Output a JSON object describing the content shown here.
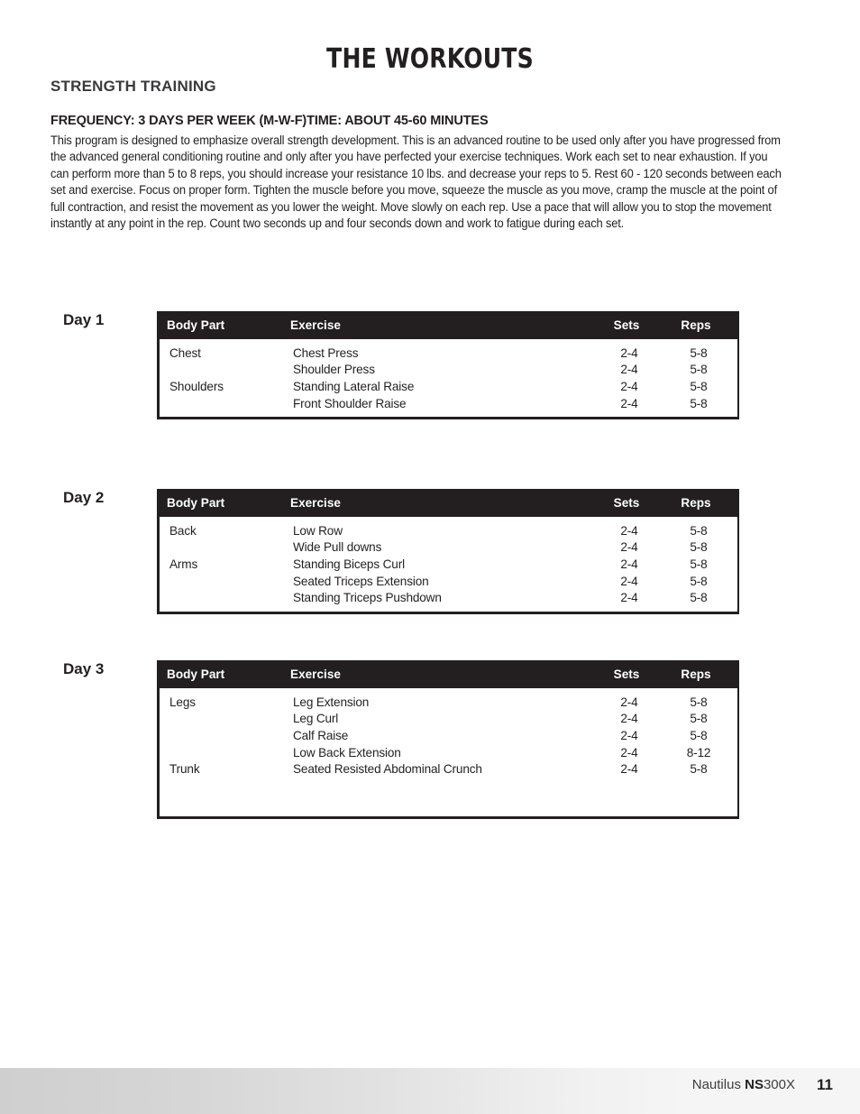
{
  "document": {
    "title": "THE WORKOUTS",
    "section_heading": "STRENGTH TRAINING",
    "frequency_heading": "FREQUENCY: 3 DAYS PER WEEK (M-W-F)TIME: ABOUT 45-60 MINUTES",
    "intro_paragraph": "This program is designed to emphasize overall strength development. This is an advanced routine to be used only after you have progressed from the advanced general conditioning routine and only after you have perfected your exercise techniques. Work each set to near exhaustion. If you can perform more than 5 to 8 reps, you should increase your resistance 10 lbs. and decrease your reps to 5. Rest 60 - 120 seconds between each set and exercise. Focus on proper form. Tighten the muscle before you move, squeeze the muscle as you move, cramp the muscle at the point of full contraction, and resist the movement as you lower the weight. Move slowly on each rep. Use a pace that will allow you to stop the movement instantly at any point in the rep. Count two seconds up and four seconds down and work to fatigue during each set."
  },
  "table_columns": {
    "body_part": "Body Part",
    "exercise": "Exercise",
    "sets": "Sets",
    "reps": "Reps"
  },
  "days": [
    {
      "label": "Day 1",
      "rows": [
        {
          "body_part": "Chest",
          "exercise": "Chest Press",
          "sets": "2-4",
          "reps": "5-8"
        },
        {
          "body_part": "",
          "exercise": "Shoulder Press",
          "sets": "2-4",
          "reps": "5-8"
        },
        {
          "body_part": "Shoulders",
          "exercise": "Standing Lateral Raise",
          "sets": "2-4",
          "reps": "5-8"
        },
        {
          "body_part": "",
          "exercise": "Front Shoulder Raise",
          "sets": "2-4",
          "reps": "5-8"
        }
      ],
      "trailing_blank_rows": 0
    },
    {
      "label": "Day 2",
      "rows": [
        {
          "body_part": "Back",
          "exercise": "Low Row",
          "sets": "2-4",
          "reps": "5-8"
        },
        {
          "body_part": "",
          "exercise": "Wide Pull downs",
          "sets": "2-4",
          "reps": "5-8"
        },
        {
          "body_part": "Arms",
          "exercise": "Standing Biceps Curl",
          "sets": "2-4",
          "reps": "5-8"
        },
        {
          "body_part": "",
          "exercise": "Seated Triceps Extension",
          "sets": "2-4",
          "reps": "5-8"
        },
        {
          "body_part": "",
          "exercise": "Standing Triceps Pushdown",
          "sets": "2-4",
          "reps": "5-8"
        }
      ],
      "trailing_blank_rows": 0
    },
    {
      "label": "Day 3",
      "rows": [
        {
          "body_part": "Legs",
          "exercise": "Leg Extension",
          "sets": "2-4",
          "reps": "5-8"
        },
        {
          "body_part": "",
          "exercise": "Leg Curl",
          "sets": "2-4",
          "reps": "5-8"
        },
        {
          "body_part": "",
          "exercise": "Calf Raise",
          "sets": "2-4",
          "reps": "5-8"
        },
        {
          "body_part": "",
          "exercise": "Low Back Extension",
          "sets": "2-4",
          "reps": "8-12"
        },
        {
          "body_part": "Trunk",
          "exercise": "Seated Resisted Abdominal Crunch",
          "sets": "2-4",
          "reps": "5-8"
        }
      ],
      "trailing_blank_rows": 2
    }
  ],
  "footer": {
    "brand": "Nautilus ",
    "model_bold": "NS",
    "model_rest": "300X",
    "page_number": "11"
  },
  "colors": {
    "ink": "#231f20",
    "header_bar": "#231f20",
    "footer_gradient_start": "#cfcfcf",
    "footer_gradient_end": "#f5f5f5"
  }
}
